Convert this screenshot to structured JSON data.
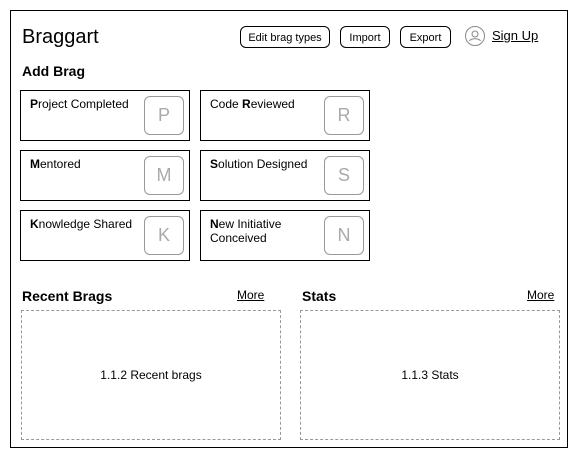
{
  "header": {
    "app_title": "Braggart",
    "edit_label": "Edit brag types",
    "import_label": "Import",
    "export_label": "Export",
    "signup_label": "Sign Up"
  },
  "add_brag": {
    "title": "Add Brag",
    "items": [
      {
        "first": "P",
        "rest": "roject Completed",
        "key": "P"
      },
      {
        "first": "C",
        "rest": "ode ",
        "bold2": "R",
        "rest2": "eviewed",
        "key": "R"
      },
      {
        "first": "M",
        "rest": "entored",
        "key": "M"
      },
      {
        "first": "S",
        "rest": "olution Designed",
        "key": "S"
      },
      {
        "first": "K",
        "rest": "nowledge Shared",
        "key": "K"
      },
      {
        "first": "N",
        "rest": "ew Initiative Conceived",
        "key": "N"
      }
    ]
  },
  "recent": {
    "title": "Recent Brags",
    "more": "More",
    "placeholder": "1.1.2 Recent brags"
  },
  "stats": {
    "title": "Stats",
    "more": "More",
    "placeholder": "1.1.3 Stats"
  }
}
